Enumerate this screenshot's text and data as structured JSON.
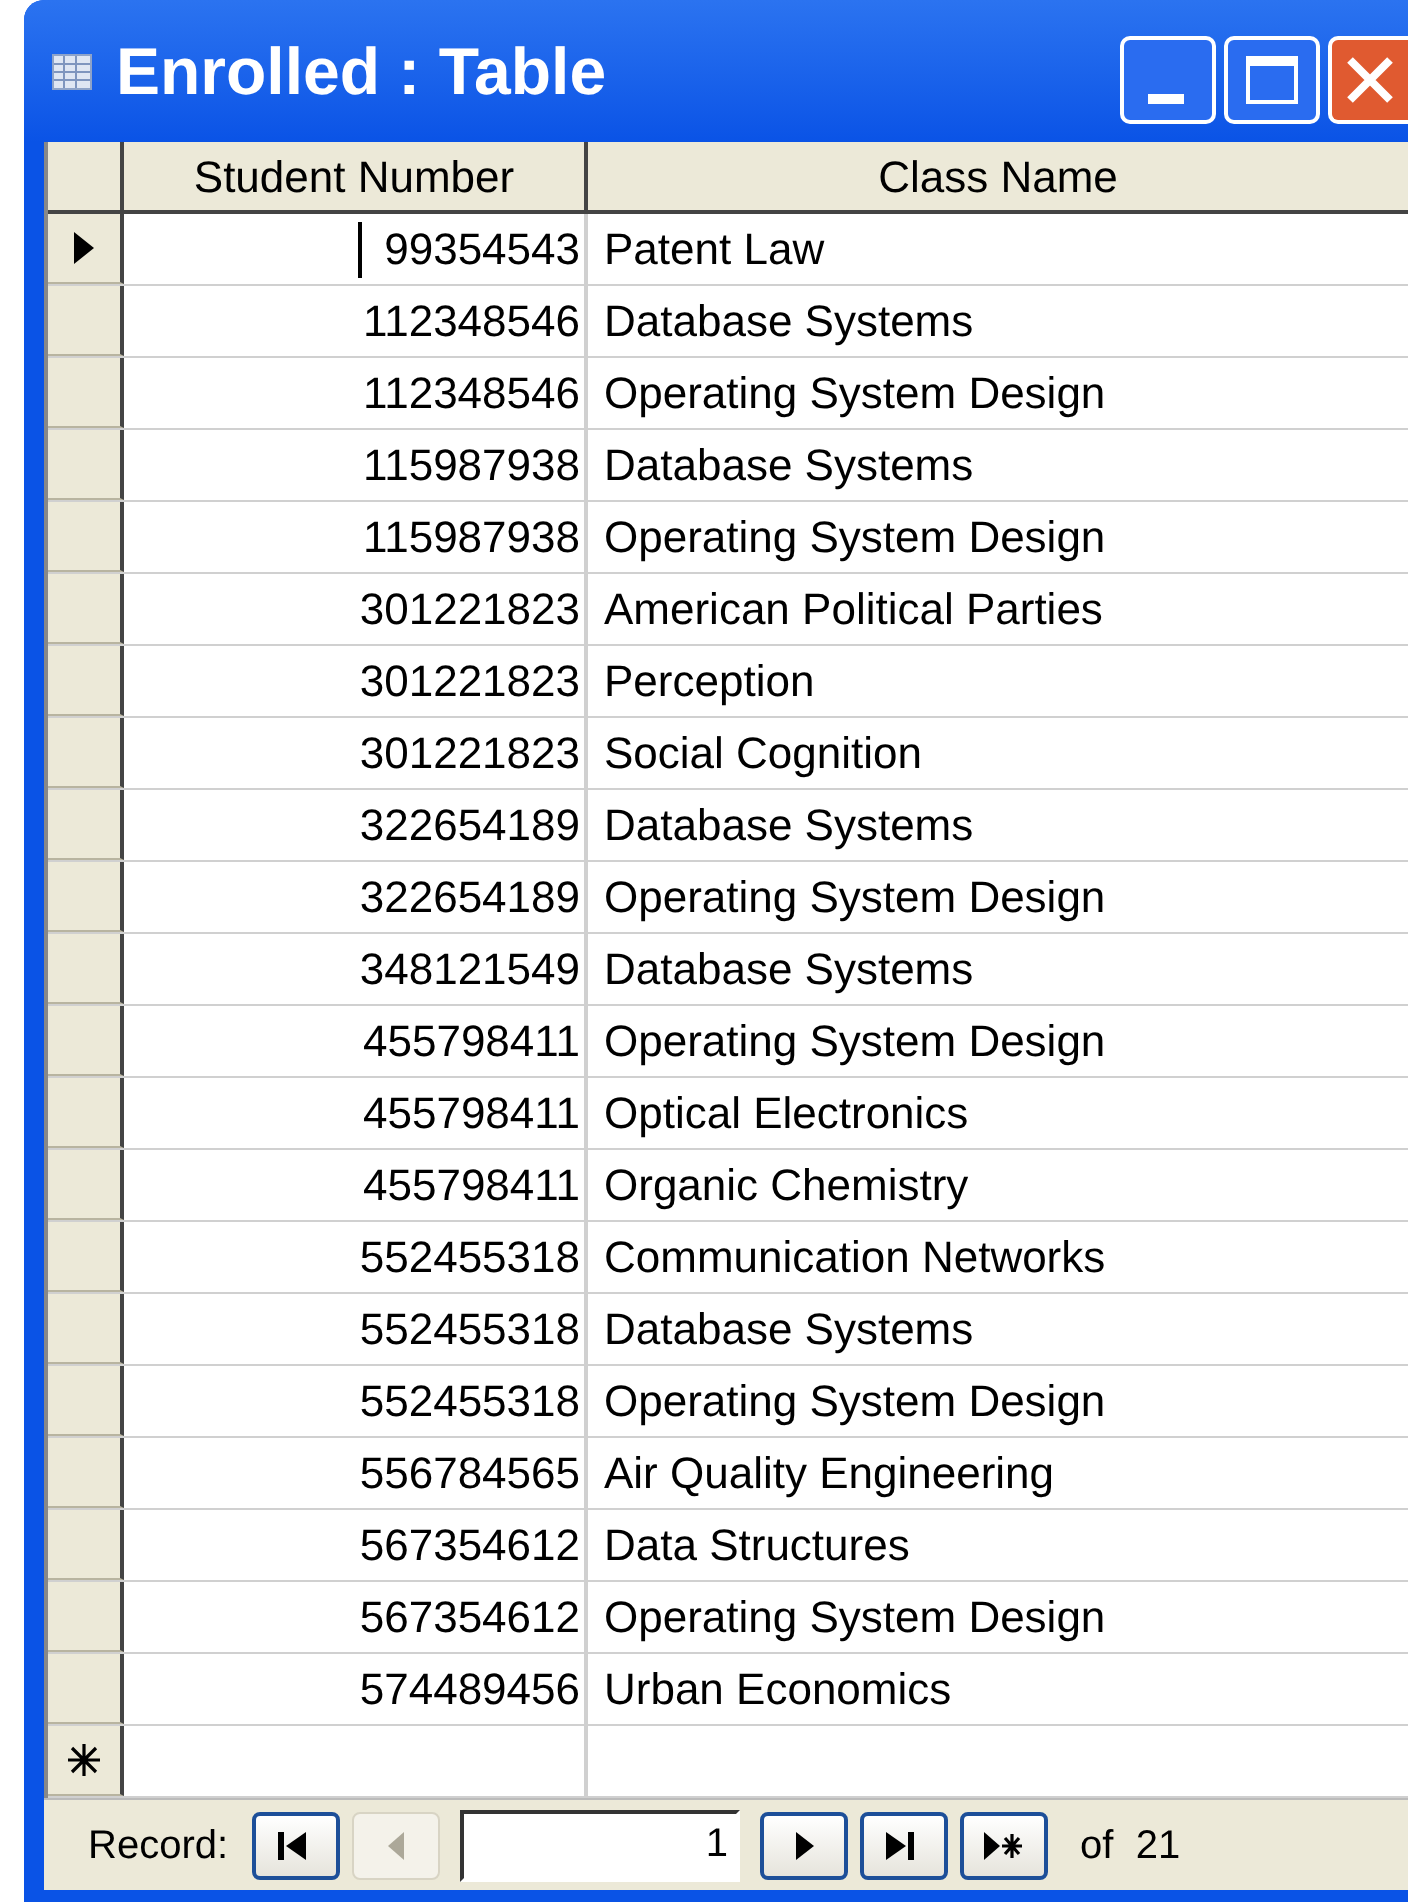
{
  "window": {
    "title": "Enrolled : Table"
  },
  "table": {
    "columns": [
      "Student Number",
      "Class Name"
    ],
    "rows": [
      {
        "student_number": "99354543",
        "class_name": "Patent Law",
        "selected": true
      },
      {
        "student_number": "112348546",
        "class_name": "Database Systems",
        "selected": false
      },
      {
        "student_number": "112348546",
        "class_name": "Operating System Design",
        "selected": false
      },
      {
        "student_number": "115987938",
        "class_name": "Database Systems",
        "selected": false
      },
      {
        "student_number": "115987938",
        "class_name": "Operating System Design",
        "selected": false
      },
      {
        "student_number": "301221823",
        "class_name": "American Political Parties",
        "selected": false
      },
      {
        "student_number": "301221823",
        "class_name": "Perception",
        "selected": false
      },
      {
        "student_number": "301221823",
        "class_name": "Social Cognition",
        "selected": false
      },
      {
        "student_number": "322654189",
        "class_name": "Database Systems",
        "selected": false
      },
      {
        "student_number": "322654189",
        "class_name": "Operating System Design",
        "selected": false
      },
      {
        "student_number": "348121549",
        "class_name": "Database Systems",
        "selected": false
      },
      {
        "student_number": "455798411",
        "class_name": "Operating System Design",
        "selected": false
      },
      {
        "student_number": "455798411",
        "class_name": "Optical Electronics",
        "selected": false
      },
      {
        "student_number": "455798411",
        "class_name": "Organic Chemistry",
        "selected": false
      },
      {
        "student_number": "552455318",
        "class_name": "Communication Networks",
        "selected": false
      },
      {
        "student_number": "552455318",
        "class_name": "Database Systems",
        "selected": false
      },
      {
        "student_number": "552455318",
        "class_name": "Operating System Design",
        "selected": false
      },
      {
        "student_number": "556784565",
        "class_name": "Air Quality Engineering",
        "selected": false
      },
      {
        "student_number": "567354612",
        "class_name": "Data Structures",
        "selected": false
      },
      {
        "student_number": "567354612",
        "class_name": "Operating System Design",
        "selected": false
      },
      {
        "student_number": "574489456",
        "class_name": "Urban Economics",
        "selected": false
      }
    ]
  },
  "navigator": {
    "label": "Record:",
    "current": "1",
    "total": "of  21",
    "buttons": [
      {
        "kind": "first",
        "disabled": false
      },
      {
        "kind": "previous",
        "disabled": true
      },
      {
        "kind": "next",
        "disabled": false
      },
      {
        "kind": "last",
        "disabled": false
      },
      {
        "kind": "new",
        "disabled": false
      }
    ]
  }
}
